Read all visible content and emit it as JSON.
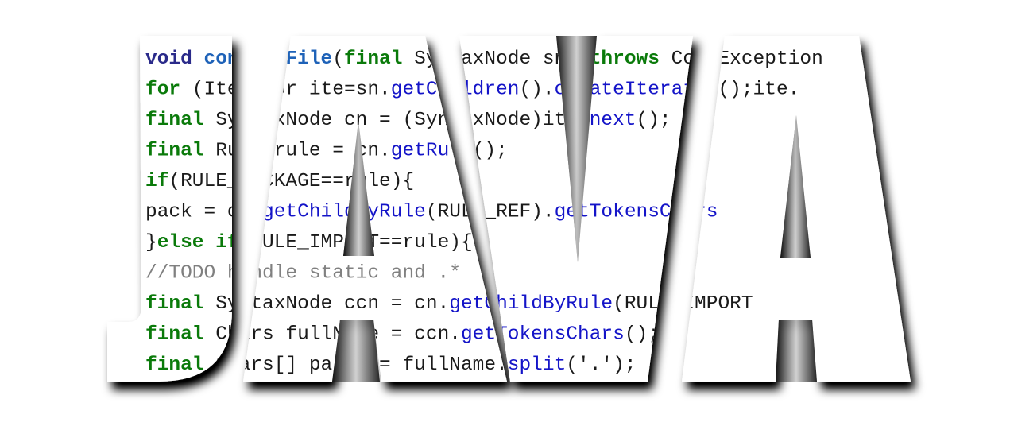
{
  "logo": {
    "word": "JAVA",
    "letters": [
      "J",
      "A",
      "V",
      "A"
    ]
  },
  "colors": {
    "background": "#ffffff",
    "letter_fill": "#ffffff",
    "shadow": "#000000",
    "plain": "#1a1a1a",
    "keyword_green": "#0a7a0a",
    "keyword_navy": "#2a2a8a",
    "method_blue": "#1414c8",
    "method_decl_blue": "#1e62b8",
    "comment_gray": "#808080"
  },
  "code_lines": [
    [
      {
        "t": "void ",
        "c": "keyword_navy",
        "b": true
      },
      {
        "t": "convertFile",
        "c": "method_decl_blue",
        "b": true
      },
      {
        "t": "(",
        "c": "plain"
      },
      {
        "t": "final",
        "c": "keyword_green",
        "b": true
      },
      {
        "t": " SyntaxNode sn) ",
        "c": "plain"
      },
      {
        "t": "throws",
        "c": "keyword_green",
        "b": true
      },
      {
        "t": " CodeException",
        "c": "plain"
      }
    ],
    [
      {
        "t": "for",
        "c": "keyword_green",
        "b": true
      },
      {
        "t": " (Iterator ite=sn.",
        "c": "plain"
      },
      {
        "t": "getChildren",
        "c": "method_blue"
      },
      {
        "t": "().",
        "c": "plain"
      },
      {
        "t": "createIterator",
        "c": "method_blue"
      },
      {
        "t": "();ite.",
        "c": "plain"
      }
    ],
    [
      {
        "t": "    "
      },
      {
        "t": "final",
        "c": "keyword_green",
        "b": true
      },
      {
        "t": " SyntaxNode cn = (SyntaxNode)ite.",
        "c": "plain"
      },
      {
        "t": "next",
        "c": "method_blue"
      },
      {
        "t": "();",
        "c": "plain"
      }
    ],
    [
      {
        "t": "    "
      },
      {
        "t": "final",
        "c": "keyword_green",
        "b": true
      },
      {
        "t": " Rule rule = cn.",
        "c": "plain"
      },
      {
        "t": "getRule",
        "c": "method_blue"
      },
      {
        "t": "();",
        "c": "plain"
      }
    ],
    [
      {
        "t": "    "
      },
      {
        "t": "if",
        "c": "keyword_green",
        "b": true
      },
      {
        "t": "(RULE_PACKAGE==rule){",
        "c": "plain"
      }
    ],
    [
      {
        "t": "        pack = cn.",
        "c": "plain"
      },
      {
        "t": "getChildByRule",
        "c": "method_blue"
      },
      {
        "t": "(RULE_REF).",
        "c": "plain"
      },
      {
        "t": "getTokensChars",
        "c": "method_blue"
      }
    ],
    [
      {
        "t": "    }",
        "c": "plain"
      },
      {
        "t": "else",
        "c": "keyword_green",
        "b": true
      },
      {
        "t": " ",
        "c": "plain"
      },
      {
        "t": "if",
        "c": "keyword_green",
        "b": true
      },
      {
        "t": "(RULE_IMPORT==rule){",
        "c": "plain"
      }
    ],
    [
      {
        "t": "        //TODO handle static and .*",
        "c": "comment_gray"
      }
    ],
    [
      {
        "t": "        "
      },
      {
        "t": "final",
        "c": "keyword_green",
        "b": true
      },
      {
        "t": " SyntaxNode ccn = cn.",
        "c": "plain"
      },
      {
        "t": "getChildByRule",
        "c": "method_blue"
      },
      {
        "t": "(RULE_IMPORT",
        "c": "plain"
      }
    ],
    [
      {
        "t": "        "
      },
      {
        "t": "final",
        "c": "keyword_green",
        "b": true
      },
      {
        "t": " Chars fullName = ccn.",
        "c": "plain"
      },
      {
        "t": "getTokensChars",
        "c": "method_blue"
      },
      {
        "t": "();",
        "c": "plain"
      }
    ],
    [
      {
        "t": "        "
      },
      {
        "t": "final",
        "c": "keyword_green",
        "b": true
      },
      {
        "t": " Chars[] parts = fullName.",
        "c": "plain"
      },
      {
        "t": "split",
        "c": "method_blue"
      },
      {
        "t": "('.')",
        "c": "plain"
      },
      {
        "t": ";",
        "c": "plain"
      }
    ]
  ]
}
